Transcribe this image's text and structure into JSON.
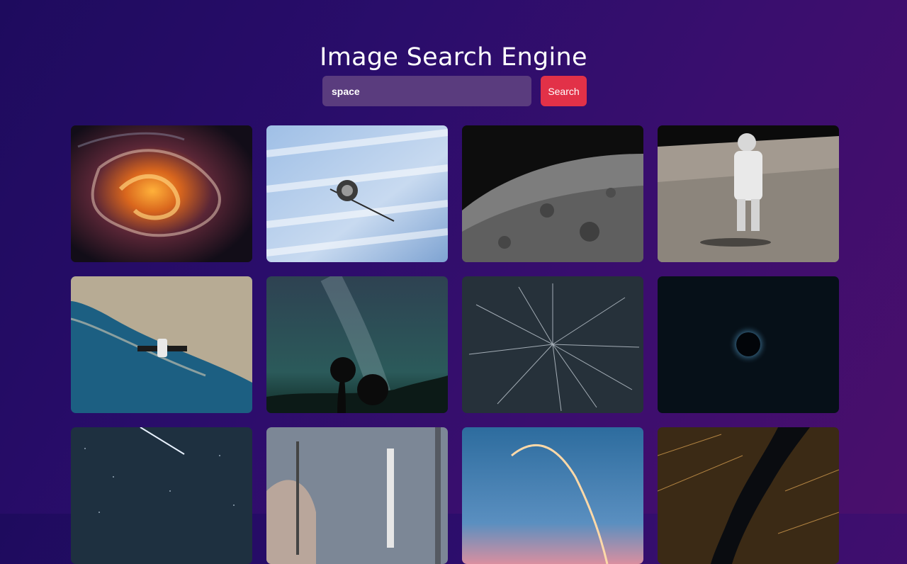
{
  "header": {
    "title": "Image Search Engine"
  },
  "search": {
    "value": "space",
    "button_label": "Search"
  },
  "results": [
    {
      "name": "nebula-image"
    },
    {
      "name": "satellite-over-clouds-image"
    },
    {
      "name": "moon-surface-image"
    },
    {
      "name": "astronaut-on-moon-image"
    },
    {
      "name": "spacecraft-over-coast-image"
    },
    {
      "name": "milky-way-trees-image"
    },
    {
      "name": "star-trails-image"
    },
    {
      "name": "solar-eclipse-image"
    },
    {
      "name": "meteor-night-sky-image"
    },
    {
      "name": "rocket-launchpad-image"
    },
    {
      "name": "rocket-launch-arc-image"
    },
    {
      "name": "city-lights-aerial-image"
    }
  ]
}
